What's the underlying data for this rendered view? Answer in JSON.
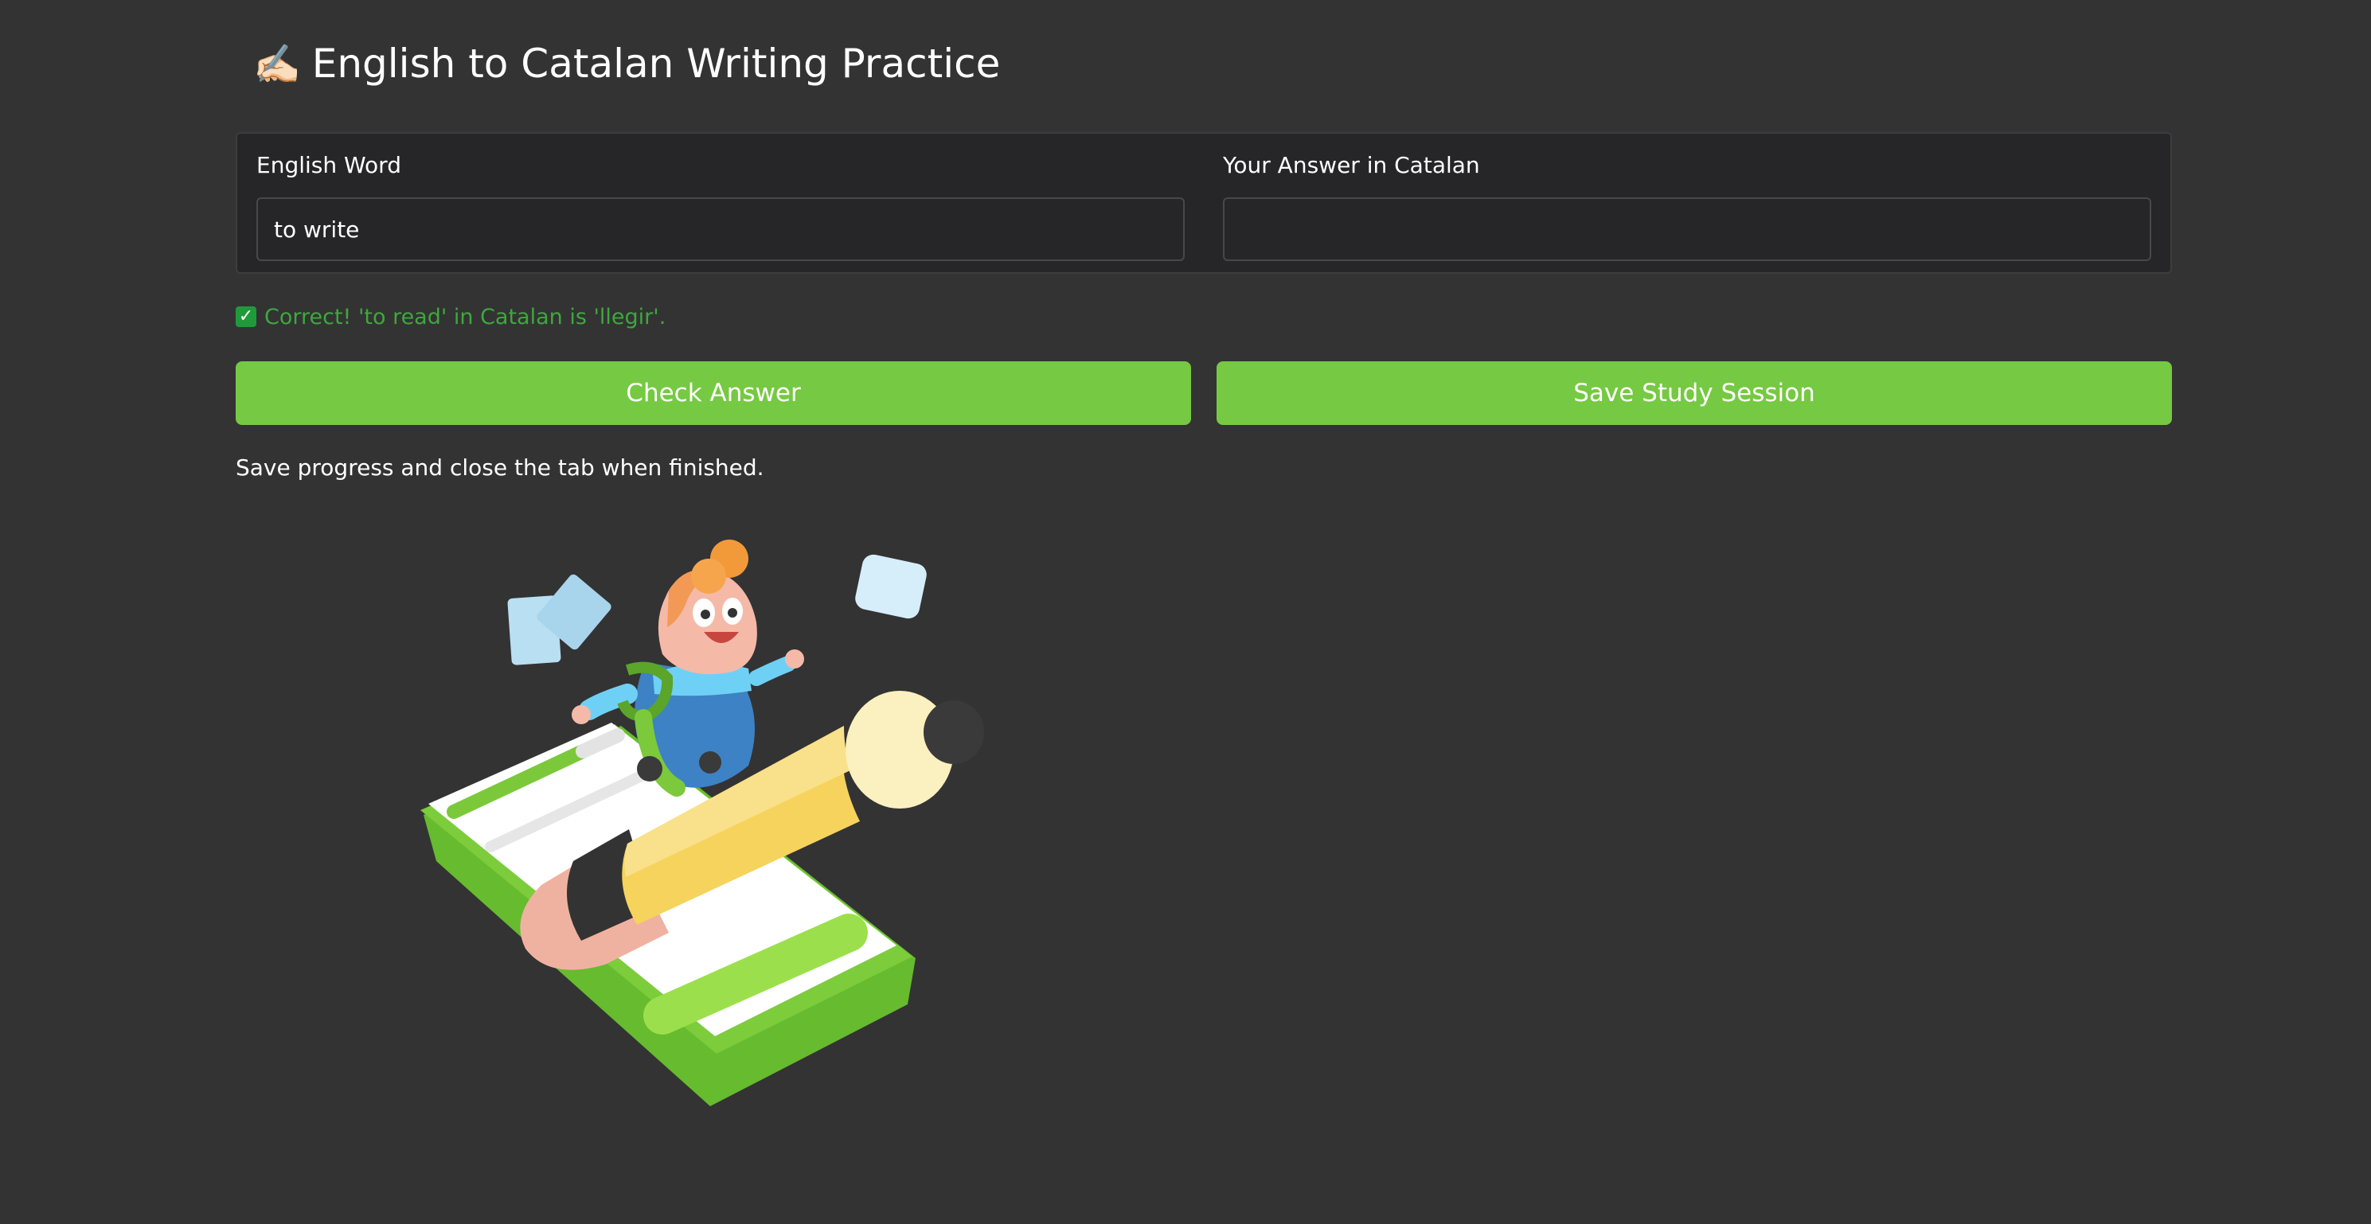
{
  "header": {
    "title_icon": "writing-hand-icon",
    "title_emoji": "✍🏻",
    "title": "English to Catalan Writing Practice"
  },
  "form": {
    "english_label": "English Word",
    "english_value": "to write",
    "catalan_label": "Your Answer in Catalan",
    "catalan_value": ""
  },
  "feedback": {
    "icon": "check-mark-icon",
    "text": "Correct! 'to read' in Catalan is 'llegir'."
  },
  "buttons": {
    "check_label": "Check Answer",
    "save_label": "Save Study Session"
  },
  "note": "Save progress and close the tab when finished.",
  "colors": {
    "background": "#333333",
    "panel": "#262628",
    "accent_green": "#76c942",
    "success_text": "#3ea73e"
  }
}
